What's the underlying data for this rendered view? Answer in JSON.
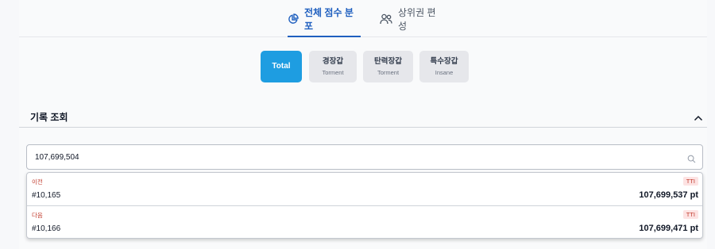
{
  "tabs": [
    {
      "label": "전체 점수 분포",
      "icon": "pie-chart-icon",
      "active": true
    },
    {
      "label": "상위권 편성",
      "icon": "users-icon",
      "active": false
    }
  ],
  "filters": [
    {
      "label": "Total",
      "sub": "",
      "active": true
    },
    {
      "label": "경장갑",
      "sub": "Torment",
      "active": false
    },
    {
      "label": "탄력장갑",
      "sub": "Torment",
      "active": false
    },
    {
      "label": "특수장갑",
      "sub": "Insane",
      "active": false
    }
  ],
  "section": {
    "title": "기록 조회",
    "collapse_icon": "chevron-up-icon"
  },
  "search": {
    "value": "107,699,504",
    "icon": "search-icon"
  },
  "results": [
    {
      "label": "이전",
      "badge": "TTI",
      "rank": "#10,165",
      "score": "107,699,537 pt"
    },
    {
      "label": "다음",
      "badge": "TTI",
      "rank": "#10,166",
      "score": "107,699,471 pt"
    }
  ],
  "colors": {
    "accent": "#1f5fbf",
    "pill_active": "#1e9de1",
    "pill_inactive": "#e6e7eb",
    "badge_bg": "#fde3e3",
    "badge_text": "#c0392b"
  }
}
